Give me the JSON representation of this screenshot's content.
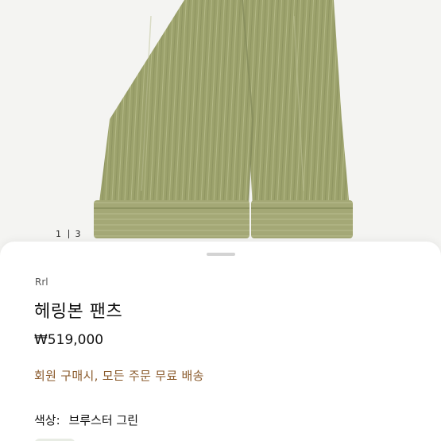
{
  "gallery": {
    "current_page": "1",
    "total_pages": "3"
  },
  "product": {
    "brand": "Rrl",
    "name": "헤링본 팬츠",
    "price": "₩519,000",
    "promo": "회원 구매시, 모든 주문 무료 배송",
    "color_label": "색상:",
    "color_value": "브루스터 그린"
  },
  "colors": {
    "pants": "#9ba06b",
    "promo_text": "#8a5a2b",
    "background": "#f3f3f1"
  }
}
